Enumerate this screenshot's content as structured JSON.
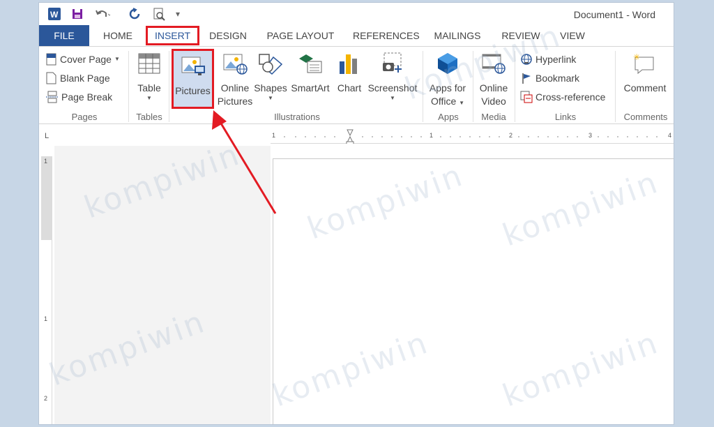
{
  "window": {
    "title": "Document1 - Word"
  },
  "tabs": [
    {
      "label": "FILE"
    },
    {
      "label": "HOME"
    },
    {
      "label": "INSERT"
    },
    {
      "label": "DESIGN"
    },
    {
      "label": "PAGE LAYOUT"
    },
    {
      "label": "REFERENCES"
    },
    {
      "label": "MAILINGS"
    },
    {
      "label": "REVIEW"
    },
    {
      "label": "VIEW"
    }
  ],
  "ribbon": {
    "pages": {
      "label": "Pages",
      "cover_page": "Cover Page",
      "blank_page": "Blank Page",
      "page_break": "Page Break"
    },
    "tables": {
      "label": "Tables",
      "table": "Table"
    },
    "illustrations": {
      "label": "Illustrations",
      "pictures": "Pictures",
      "online_pictures_1": "Online",
      "online_pictures_2": "Pictures",
      "shapes": "Shapes",
      "smartart": "SmartArt",
      "chart": "Chart",
      "screenshot": "Screenshot"
    },
    "apps": {
      "label": "Apps",
      "apps_1": "Apps for",
      "apps_2": "Office"
    },
    "media": {
      "label": "Media",
      "video_1": "Online",
      "video_2": "Video"
    },
    "links": {
      "label": "Links",
      "hyperlink": "Hyperlink",
      "bookmark": "Bookmark",
      "cross_reference": "Cross-reference"
    },
    "comments": {
      "label": "Comments",
      "comment": "Comment"
    }
  },
  "ruler": {
    "h_marks": [
      "1",
      "1",
      "2",
      "3",
      "4"
    ],
    "v_marks": [
      "1",
      "1",
      "2"
    ],
    "corner": "L"
  },
  "watermark": {
    "text": "kompiwin"
  },
  "colors": {
    "accent": "#2b579a",
    "highlight": "#e31b23",
    "selected": "#cfdcef"
  }
}
